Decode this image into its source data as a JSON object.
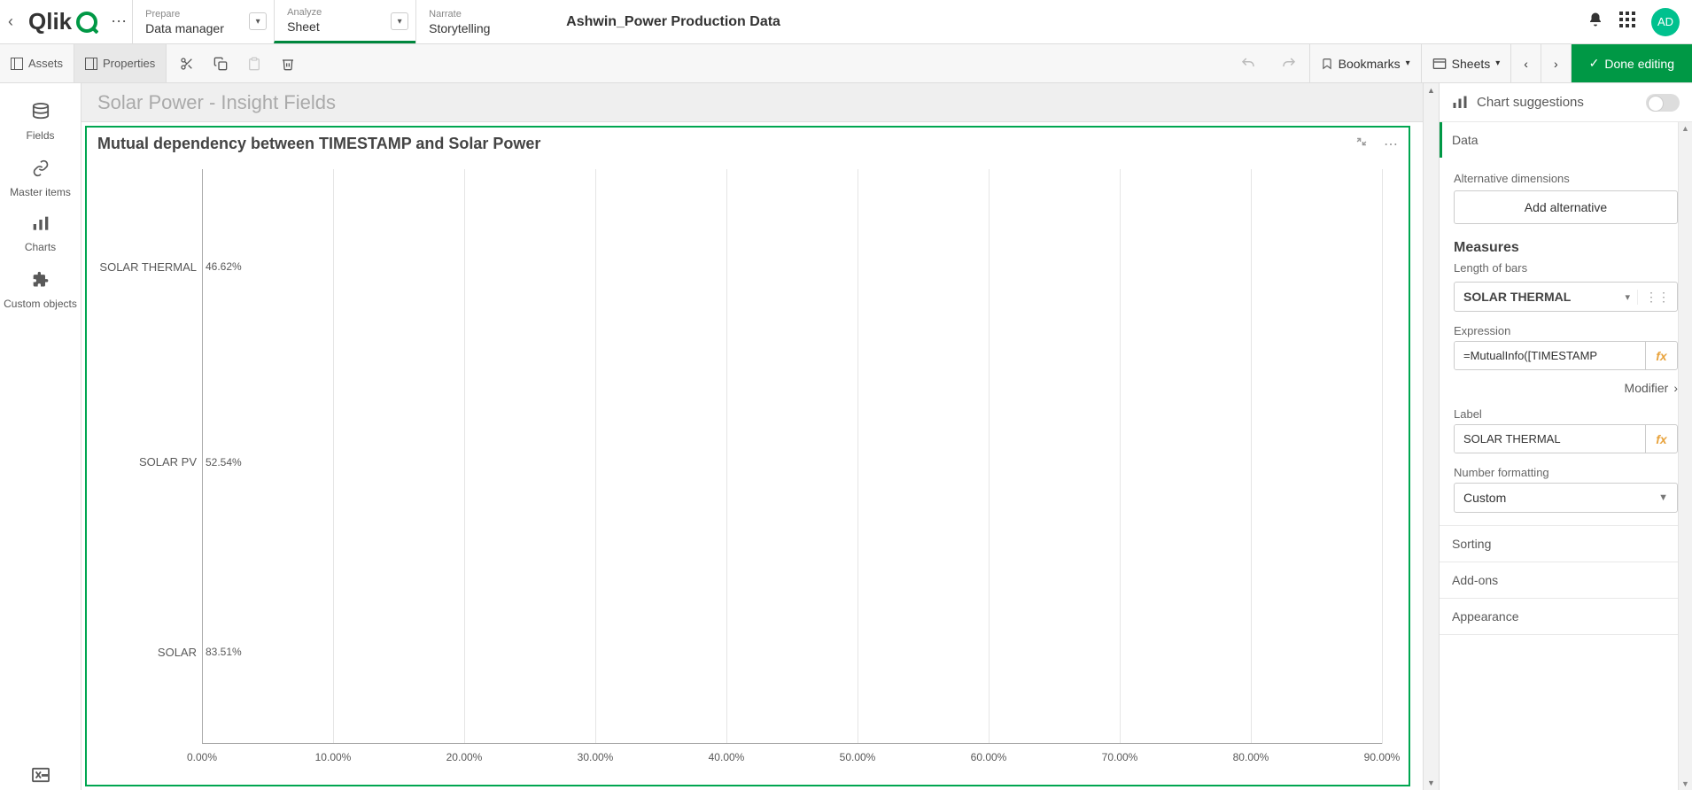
{
  "topbar": {
    "logo_text": "Qlik",
    "nav": [
      {
        "top": "Prepare",
        "bottom": "Data manager",
        "hasChevron": true
      },
      {
        "top": "Analyze",
        "bottom": "Sheet",
        "hasChevron": true,
        "active": true
      },
      {
        "top": "Narrate",
        "bottom": "Storytelling",
        "hasChevron": false
      }
    ],
    "app_title": "Ashwin_Power Production Data",
    "avatar": "AD"
  },
  "toolbar": {
    "assets": "Assets",
    "properties": "Properties",
    "bookmarks": "Bookmarks",
    "sheets": "Sheets",
    "done_editing": "Done editing"
  },
  "rail": {
    "items": [
      {
        "label": "Fields",
        "icon": "≡"
      },
      {
        "label": "Master items",
        "icon": "🔗"
      },
      {
        "label": "Charts",
        "icon": "📊"
      },
      {
        "label": "Custom objects",
        "icon": "🧩"
      }
    ]
  },
  "sheet": {
    "title": "Solar Power - Insight Fields"
  },
  "chart": {
    "title": "Mutual dependency between TIMESTAMP and Solar Power"
  },
  "chart_data": {
    "type": "bar",
    "orientation": "horizontal",
    "title": "Mutual dependency between TIMESTAMP and Solar Power",
    "categories": [
      "SOLAR THERMAL",
      "SOLAR PV",
      "SOLAR"
    ],
    "values": [
      46.62,
      52.54,
      83.51
    ],
    "value_labels": [
      "46.62%",
      "52.54%",
      "83.51%"
    ],
    "xlabel": "",
    "ylabel": "",
    "xlim": [
      0,
      90
    ],
    "xticks": [
      "0.00%",
      "10.00%",
      "20.00%",
      "30.00%",
      "40.00%",
      "50.00%",
      "60.00%",
      "70.00%",
      "80.00%",
      "90.00%"
    ],
    "bar_color": "#f8c0cb"
  },
  "prop": {
    "chart_suggestions": "Chart suggestions",
    "sections": {
      "data": "Data",
      "sorting": "Sorting",
      "addons": "Add-ons",
      "appearance": "Appearance"
    },
    "alt_dimensions": "Alternative dimensions",
    "add_alternative": "Add alternative",
    "measures": "Measures",
    "length_of_bars": "Length of bars",
    "measure_name": "SOLAR THERMAL",
    "expression_label": "Expression",
    "expression_value": "=MutualInfo([TIMESTAMP",
    "modifier": "Modifier",
    "label_label": "Label",
    "label_value": "SOLAR THERMAL",
    "number_formatting": "Number formatting",
    "number_formatting_value": "Custom"
  }
}
